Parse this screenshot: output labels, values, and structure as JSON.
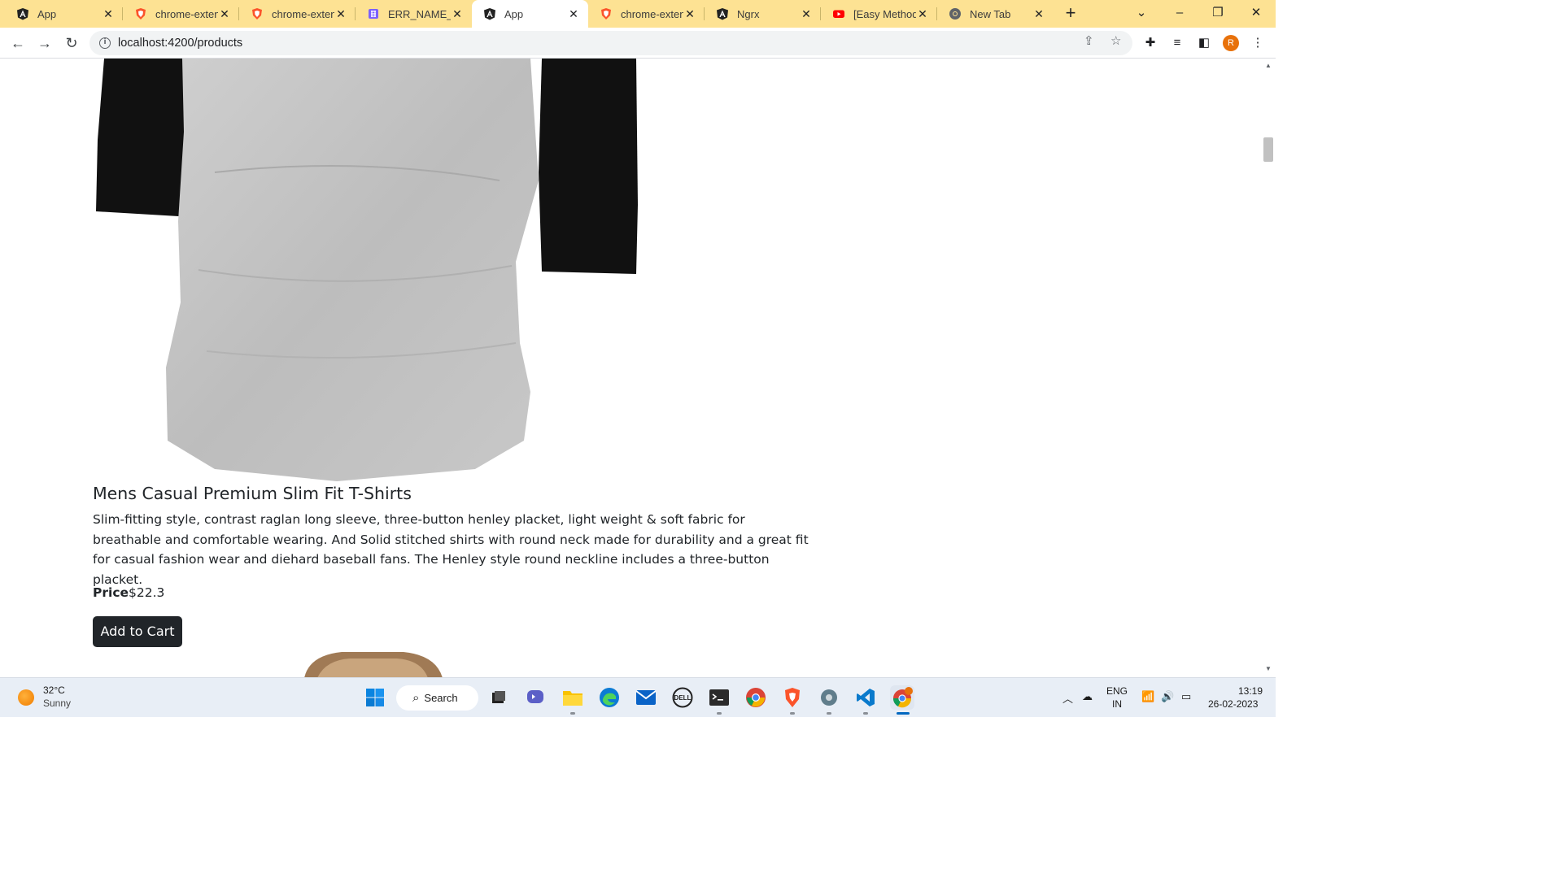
{
  "browser": {
    "tabs": [
      {
        "title": "App",
        "icon": "angular-icon",
        "active": false
      },
      {
        "title": "chrome-exten",
        "icon": "brave-shield-icon",
        "active": false
      },
      {
        "title": "chrome-exten",
        "icon": "brave-shield-icon",
        "active": false
      },
      {
        "title": "ERR_NAME_N",
        "icon": "hashnode-icon",
        "active": false
      },
      {
        "title": "App",
        "icon": "angular-icon",
        "active": true
      },
      {
        "title": "chrome-exten",
        "icon": "brave-shield-icon",
        "active": false
      },
      {
        "title": "Ngrx",
        "icon": "angular-icon",
        "active": false
      },
      {
        "title": "[Easy Method",
        "icon": "youtube-icon",
        "active": false
      },
      {
        "title": "New Tab",
        "icon": "chrome-icon",
        "active": false
      }
    ],
    "new_tab_label": "+",
    "url": "localhost:4200/products",
    "profile_initial": "R"
  },
  "product": {
    "title": "Mens Casual Premium Slim Fit T-Shirts",
    "description": "Slim-fitting style, contrast raglan long sleeve, three-button henley placket, light weight & soft fabric for breathable and comfortable wearing. And Solid stitched shirts with round neck made for durability and a great fit for casual fashion wear and diehard baseball fans. The Henley style round neckline includes a three-button placket.",
    "price_label": "Price",
    "price_value": "$22.3",
    "add_to_cart_label": "Add to Cart"
  },
  "taskbar": {
    "weather_temp": "32°C",
    "weather_condition": "Sunny",
    "search_label": "Search",
    "language_line1": "ENG",
    "language_line2": "IN",
    "time": "13:19",
    "date": "26-02-2023"
  },
  "colors": {
    "tabstrip_bg": "#fde293",
    "button_dark": "#212529",
    "taskbar_bg": "#e8eef6"
  }
}
